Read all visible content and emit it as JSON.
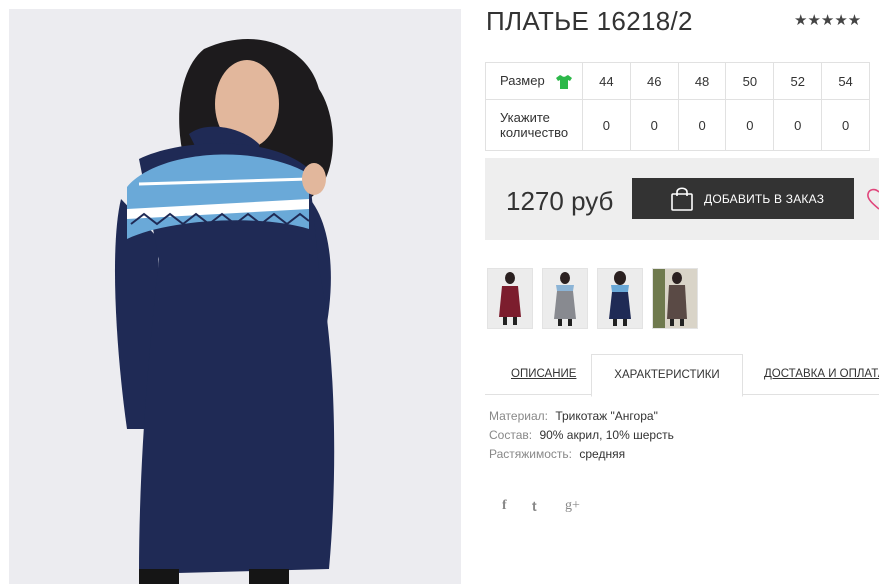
{
  "product": {
    "title": "ПЛАТЬЕ 16218/2",
    "rating_stars": "★★★★★"
  },
  "sizes": {
    "size_label": "Размер",
    "qty_label": "Укажите количество",
    "values": [
      "44",
      "46",
      "48",
      "50",
      "52",
      "54"
    ],
    "quantities": [
      "0",
      "0",
      "0",
      "0",
      "0",
      "0"
    ]
  },
  "purchase": {
    "price": "1270 руб",
    "add_button": "ДОБАВИТЬ В ЗАКАЗ"
  },
  "tabs": {
    "description": "ОПИСАНИЕ",
    "characteristics": "ХАРАКТЕРИСТИКИ",
    "delivery": "ДОСТАВКА И ОПЛАТА"
  },
  "specs": {
    "material_label": "Материал:",
    "material_value": "Трикотаж \"Ангора\"",
    "composition_label": "Состав:",
    "composition_value": "90% акрил, 10% шерсть",
    "stretch_label": "Растяжимость:",
    "stretch_value": "средняя"
  },
  "social": {
    "facebook": "f",
    "twitter": "t",
    "googleplus": "g+"
  },
  "colors": {
    "accent_dark": "#333333",
    "dress_navy": "#1f2a55",
    "size_icon_green": "#2db84a",
    "heart_pink": "#e0457b"
  }
}
